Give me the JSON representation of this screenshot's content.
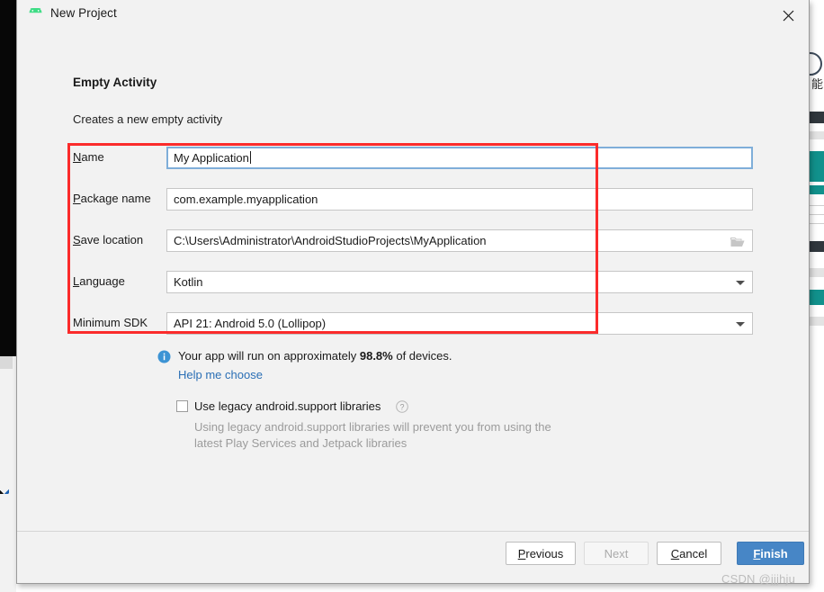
{
  "window": {
    "title": "New Project",
    "app_icon": "android-robot-icon",
    "close_icon": "close-icon"
  },
  "step": {
    "title": "Empty Activity",
    "description": "Creates a new empty activity"
  },
  "form": {
    "fields": [
      {
        "label_prefix": "N",
        "label_rest": "ame",
        "name": "name",
        "value": "My Application",
        "control": "text",
        "focused": true
      },
      {
        "label_prefix": "P",
        "label_rest": "ackage name",
        "name": "package-name",
        "value": "com.example.myapplication",
        "control": "text",
        "focused": false
      },
      {
        "label_prefix": "S",
        "label_rest": "ave location",
        "name": "save-location",
        "value": "C:\\Users\\Administrator\\AndroidStudioProjects\\MyApplication",
        "control": "text-with-browse",
        "browse_icon": "folder-icon",
        "focused": false
      },
      {
        "label_prefix": "L",
        "label_rest": "anguage",
        "name": "language",
        "value": "Kotlin",
        "control": "combo",
        "focused": false
      },
      {
        "label_prefix": "",
        "label_rest": "Minimum SDK",
        "name": "minimum-sdk",
        "value": "API 21: Android 5.0 (Lollipop)",
        "control": "combo",
        "focused": false
      }
    ]
  },
  "info": {
    "icon": "info-icon",
    "text_before": "Your app will run on approximately ",
    "percent": "98.8%",
    "text_after": " of devices.",
    "link": "Help me choose"
  },
  "legacy": {
    "checked": false,
    "label": "Use legacy android.support libraries",
    "help_icon": "question-mark-icon",
    "description": "Using legacy android.support libraries will prevent you from using the latest Play Services and Jetpack libraries"
  },
  "footer": {
    "previous": {
      "prefix": "P",
      "rest": "revious"
    },
    "next": {
      "prefix": "",
      "rest": "Next"
    },
    "cancel": {
      "prefix": "C",
      "rest": "ancel"
    },
    "finish": {
      "prefix": "F",
      "rest": "inish"
    }
  },
  "watermark": "CSDN @jjjhju",
  "colors": {
    "accent": "#4786c6",
    "annotation": "#fb2b2b",
    "link": "#2b6fb5",
    "android_green": "#3ddc84"
  }
}
